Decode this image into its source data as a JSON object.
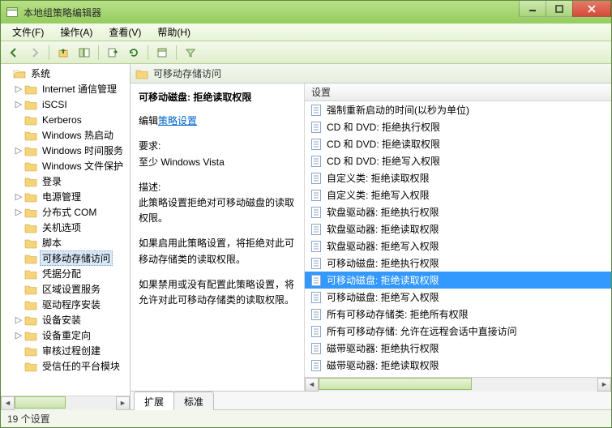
{
  "window": {
    "title": "本地组策略编辑器"
  },
  "menu": {
    "file": "文件(F)",
    "action": "操作(A)",
    "view": "查看(V)",
    "help": "帮助(H)"
  },
  "tree": {
    "root": "系统",
    "items": [
      {
        "label": "Internet 通信管理",
        "expandable": true
      },
      {
        "label": "iSCSI",
        "expandable": true
      },
      {
        "label": "Kerberos",
        "expandable": false
      },
      {
        "label": "Windows 热启动",
        "expandable": false
      },
      {
        "label": "Windows 时间服务",
        "expandable": true
      },
      {
        "label": "Windows 文件保护",
        "expandable": false
      },
      {
        "label": "登录",
        "expandable": false
      },
      {
        "label": "电源管理",
        "expandable": true
      },
      {
        "label": "分布式 COM",
        "expandable": true
      },
      {
        "label": "关机选项",
        "expandable": false
      },
      {
        "label": "脚本",
        "expandable": false
      },
      {
        "label": "可移动存储访问",
        "expandable": false,
        "selected": true
      },
      {
        "label": "凭据分配",
        "expandable": false
      },
      {
        "label": "区域设置服务",
        "expandable": false
      },
      {
        "label": "驱动程序安装",
        "expandable": false
      },
      {
        "label": "设备安装",
        "expandable": true
      },
      {
        "label": "设备重定向",
        "expandable": true
      },
      {
        "label": "审核过程创建",
        "expandable": false
      },
      {
        "label": "受信任的平台模块",
        "expandable": false
      }
    ]
  },
  "header": {
    "title": "可移动存储访问"
  },
  "desc": {
    "title": "可移动磁盘: 拒绝读取权限",
    "edit_prefix": "编辑",
    "edit_link": "策略设置",
    "req_label": "要求:",
    "req_text": "至少 Windows Vista",
    "desc_label": "描述:",
    "p1": "此策略设置拒绝对可移动磁盘的读取权限。",
    "p2": "如果启用此策略设置，将拒绝对此可移动存储类的读取权限。",
    "p3": "如果禁用或没有配置此策略设置，将允许对此可移动存储类的读取权限。"
  },
  "list": {
    "header": "设置",
    "items": [
      "强制重新启动的时间(以秒为单位)",
      "CD 和 DVD: 拒绝执行权限",
      "CD 和 DVD: 拒绝读取权限",
      "CD 和 DVD: 拒绝写入权限",
      "自定义类: 拒绝读取权限",
      "自定义类: 拒绝写入权限",
      "软盘驱动器: 拒绝执行权限",
      "软盘驱动器: 拒绝读取权限",
      "软盘驱动器: 拒绝写入权限",
      "可移动磁盘: 拒绝执行权限",
      "可移动磁盘: 拒绝读取权限",
      "可移动磁盘: 拒绝写入权限",
      "所有可移动存储类: 拒绝所有权限",
      "所有可移动存储: 允许在远程会话中直接访问",
      "磁带驱动器: 拒绝执行权限",
      "磁带驱动器: 拒绝读取权限"
    ],
    "selected_index": 10
  },
  "tabs": {
    "extended": "扩展",
    "standard": "标准"
  },
  "status": {
    "text": "19 个设置"
  }
}
